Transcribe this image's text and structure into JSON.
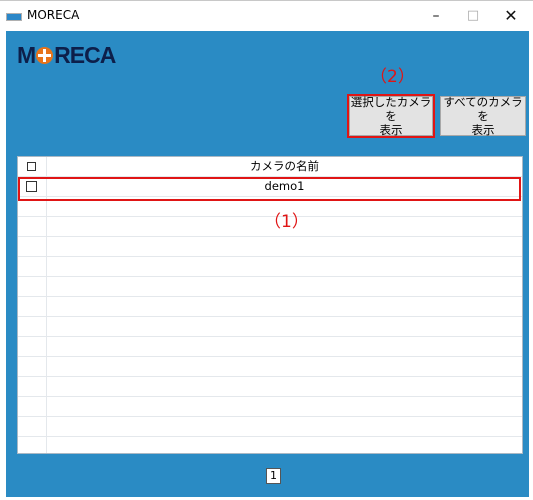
{
  "window": {
    "title": "MORECA",
    "minimize_glyph": "–",
    "maximize_glyph": "□",
    "close_glyph": "✕"
  },
  "logo": {
    "left": "M",
    "right": "RECA"
  },
  "annotations": {
    "one": "（1）",
    "two": "（2）"
  },
  "buttons": {
    "show_selected_line1": "選択したカメラを",
    "show_selected_line2": "表示",
    "show_all_line1": "すべてのカメラを",
    "show_all_line2": "表示"
  },
  "grid": {
    "header": "カメラの名前",
    "rows": [
      {
        "name": "demo1",
        "checked": false
      }
    ]
  },
  "pager": {
    "current_page": "1"
  },
  "colors": {
    "background": "#2a8bc4",
    "annotation": "#e01515",
    "logo_accent": "#e8731a"
  },
  "icons": {
    "app": "moreca-app-icon",
    "logo_mark": "crosshair-icon"
  }
}
